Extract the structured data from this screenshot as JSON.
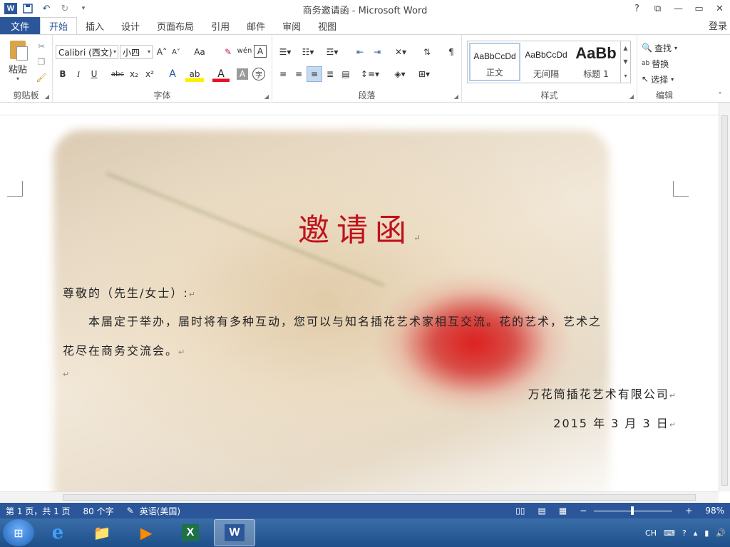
{
  "window": {
    "title": "商务邀请函 - Microsoft Word",
    "login": "登录",
    "help_glyph": "?",
    "controls": [
      "⧉",
      "—",
      "▭",
      "✕"
    ]
  },
  "qat": {
    "app_letter": "W",
    "save": "💾",
    "undo": "↶",
    "redo": "↻"
  },
  "tabs": {
    "file": "文件",
    "items": [
      "开始",
      "插入",
      "设计",
      "页面布局",
      "引用",
      "邮件",
      "审阅",
      "视图"
    ],
    "active": "开始"
  },
  "ribbon": {
    "clipboard": {
      "label": "剪贴板",
      "paste": "粘贴"
    },
    "font": {
      "label": "字体",
      "name": "Calibri (西文)",
      "size": "小四",
      "grow": "A˄",
      "shrink": "A˅",
      "case": "Aa",
      "bold": "B",
      "italic": "I",
      "underline": "U",
      "strike": "abc",
      "sub": "x₂",
      "sup": "x²",
      "phonetic": "wén",
      "border_char": "A",
      "effects": "A",
      "highlight": "ab",
      "color": "A",
      "shading": "A",
      "enclose": "字"
    },
    "paragraph": {
      "label": "段落"
    },
    "styles": {
      "label": "样式",
      "items": [
        {
          "sample": "AaBbCcDd",
          "name": "正文"
        },
        {
          "sample": "AaBbCcDd",
          "name": "无间隔"
        },
        {
          "sample": "AaBb",
          "name": "标题 1"
        }
      ]
    },
    "editing": {
      "label": "编辑",
      "find": "查找",
      "replace": "替换",
      "select": "选择"
    }
  },
  "document": {
    "title": "邀请函",
    "greeting": "尊敬的（先生/女士）:",
    "body_line1": "本届定于举办，届时将有多种互动，您可以与知名插花艺术家相互交流。花的艺术，艺术之",
    "body_line2": "花尽在商务交流会。",
    "company": "万花筒插花艺术有限公司",
    "date": "2015 年 3 月 3 日",
    "pilcrow": "↵"
  },
  "statusbar": {
    "page": "第 1 页，共 1 页",
    "words": "80 个字",
    "language": "英语(美国)",
    "zoom": "98%",
    "zoom_percent": 98
  },
  "taskbar": {
    "apps": [
      "e",
      "📁",
      "▶",
      "X",
      "W"
    ],
    "tray_lang": "CH"
  },
  "colors": {
    "accent": "#2b579a",
    "title_red": "#c0121c"
  }
}
